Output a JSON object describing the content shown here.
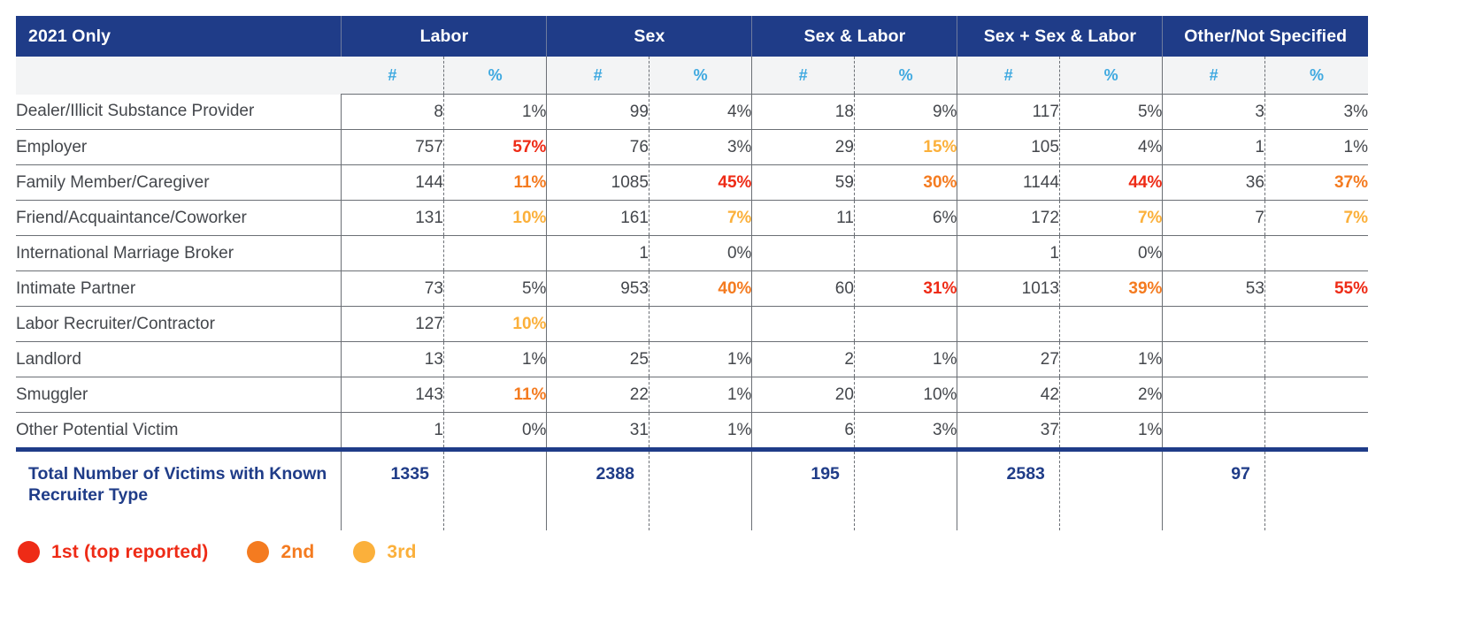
{
  "table": {
    "corner_label": "2021 Only",
    "groups": [
      {
        "label": "Labor"
      },
      {
        "label": "Sex"
      },
      {
        "label": "Sex & Labor"
      },
      {
        "label": "Sex + Sex & Labor"
      },
      {
        "label": "Other/Not Specified"
      }
    ],
    "sub_headers": {
      "count": "#",
      "percent": "%"
    },
    "rows": [
      {
        "label": "Dealer/Illicit Substance Provider",
        "cells": [
          {
            "n": "8",
            "p": "1%",
            "rank": 0
          },
          {
            "n": "99",
            "p": "4%",
            "rank": 0
          },
          {
            "n": "18",
            "p": "9%",
            "rank": 0
          },
          {
            "n": "117",
            "p": "5%",
            "rank": 0
          },
          {
            "n": "3",
            "p": "3%",
            "rank": 0
          }
        ]
      },
      {
        "label": "Employer",
        "cells": [
          {
            "n": "757",
            "p": "57%",
            "rank": 1
          },
          {
            "n": "76",
            "p": "3%",
            "rank": 0
          },
          {
            "n": "29",
            "p": "15%",
            "rank": 3
          },
          {
            "n": "105",
            "p": "4%",
            "rank": 0
          },
          {
            "n": "1",
            "p": "1%",
            "rank": 0
          }
        ]
      },
      {
        "label": "Family Member/Caregiver",
        "cells": [
          {
            "n": "144",
            "p": "11%",
            "rank": 2
          },
          {
            "n": "1085",
            "p": "45%",
            "rank": 1
          },
          {
            "n": "59",
            "p": "30%",
            "rank": 2
          },
          {
            "n": "1144",
            "p": "44%",
            "rank": 1
          },
          {
            "n": "36",
            "p": "37%",
            "rank": 2
          }
        ]
      },
      {
        "label": "Friend/Acquaintance/Coworker",
        "cells": [
          {
            "n": "131",
            "p": "10%",
            "rank": 3
          },
          {
            "n": "161",
            "p": "7%",
            "rank": 3
          },
          {
            "n": "11",
            "p": "6%",
            "rank": 0
          },
          {
            "n": "172",
            "p": "7%",
            "rank": 3
          },
          {
            "n": "7",
            "p": "7%",
            "rank": 3
          }
        ]
      },
      {
        "label": "International Marriage Broker",
        "cells": [
          {
            "n": "",
            "p": "",
            "rank": 0
          },
          {
            "n": "1",
            "p": "0%",
            "rank": 0
          },
          {
            "n": "",
            "p": "",
            "rank": 0
          },
          {
            "n": "1",
            "p": "0%",
            "rank": 0
          },
          {
            "n": "",
            "p": "",
            "rank": 0
          }
        ]
      },
      {
        "label": "Intimate Partner",
        "cells": [
          {
            "n": "73",
            "p": "5%",
            "rank": 0
          },
          {
            "n": "953",
            "p": "40%",
            "rank": 2
          },
          {
            "n": "60",
            "p": "31%",
            "rank": 1
          },
          {
            "n": "1013",
            "p": "39%",
            "rank": 2
          },
          {
            "n": "53",
            "p": "55%",
            "rank": 1
          }
        ]
      },
      {
        "label": "Labor Recruiter/Contractor",
        "cells": [
          {
            "n": "127",
            "p": "10%",
            "rank": 3
          },
          {
            "n": "",
            "p": "",
            "rank": 0
          },
          {
            "n": "",
            "p": "",
            "rank": 0
          },
          {
            "n": "",
            "p": "",
            "rank": 0
          },
          {
            "n": "",
            "p": "",
            "rank": 0
          }
        ]
      },
      {
        "label": "Landlord",
        "cells": [
          {
            "n": "13",
            "p": "1%",
            "rank": 0
          },
          {
            "n": "25",
            "p": "1%",
            "rank": 0
          },
          {
            "n": "2",
            "p": "1%",
            "rank": 0
          },
          {
            "n": "27",
            "p": "1%",
            "rank": 0
          },
          {
            "n": "",
            "p": "",
            "rank": 0
          }
        ]
      },
      {
        "label": "Smuggler",
        "cells": [
          {
            "n": "143",
            "p": "11%",
            "rank": 2
          },
          {
            "n": "22",
            "p": "1%",
            "rank": 0
          },
          {
            "n": "20",
            "p": "10%",
            "rank": 0
          },
          {
            "n": "42",
            "p": "2%",
            "rank": 0
          },
          {
            "n": "",
            "p": "",
            "rank": 0
          }
        ]
      },
      {
        "label": "Other Potential Victim",
        "cells": [
          {
            "n": "1",
            "p": "0%",
            "rank": 0
          },
          {
            "n": "31",
            "p": "1%",
            "rank": 0
          },
          {
            "n": "6",
            "p": "3%",
            "rank": 0
          },
          {
            "n": "37",
            "p": "1%",
            "rank": 0
          },
          {
            "n": "",
            "p": "",
            "rank": 0
          }
        ]
      }
    ],
    "total_row": {
      "label": "Total Number of Victims with Known Recruiter Type",
      "cells": [
        {
          "n": "1335",
          "p": ""
        },
        {
          "n": "2388",
          "p": ""
        },
        {
          "n": "195",
          "p": ""
        },
        {
          "n": "2583",
          "p": ""
        },
        {
          "n": "97",
          "p": ""
        }
      ]
    }
  },
  "legend": {
    "items": [
      {
        "label": "1st (top reported)",
        "color": "#EE2B16"
      },
      {
        "label": "2nd",
        "color": "#F47B20"
      },
      {
        "label": "3rd",
        "color": "#FBB03B"
      }
    ]
  },
  "colors": {
    "header_blue": "#1F3C88",
    "subheader_bg": "#F3F4F5",
    "subheader_text": "#3FA9E0",
    "grid": "#6b6f75",
    "body_text": "#44474c",
    "rank1": "#EE2B16",
    "rank2": "#F47B20",
    "rank3": "#FBB03B"
  }
}
